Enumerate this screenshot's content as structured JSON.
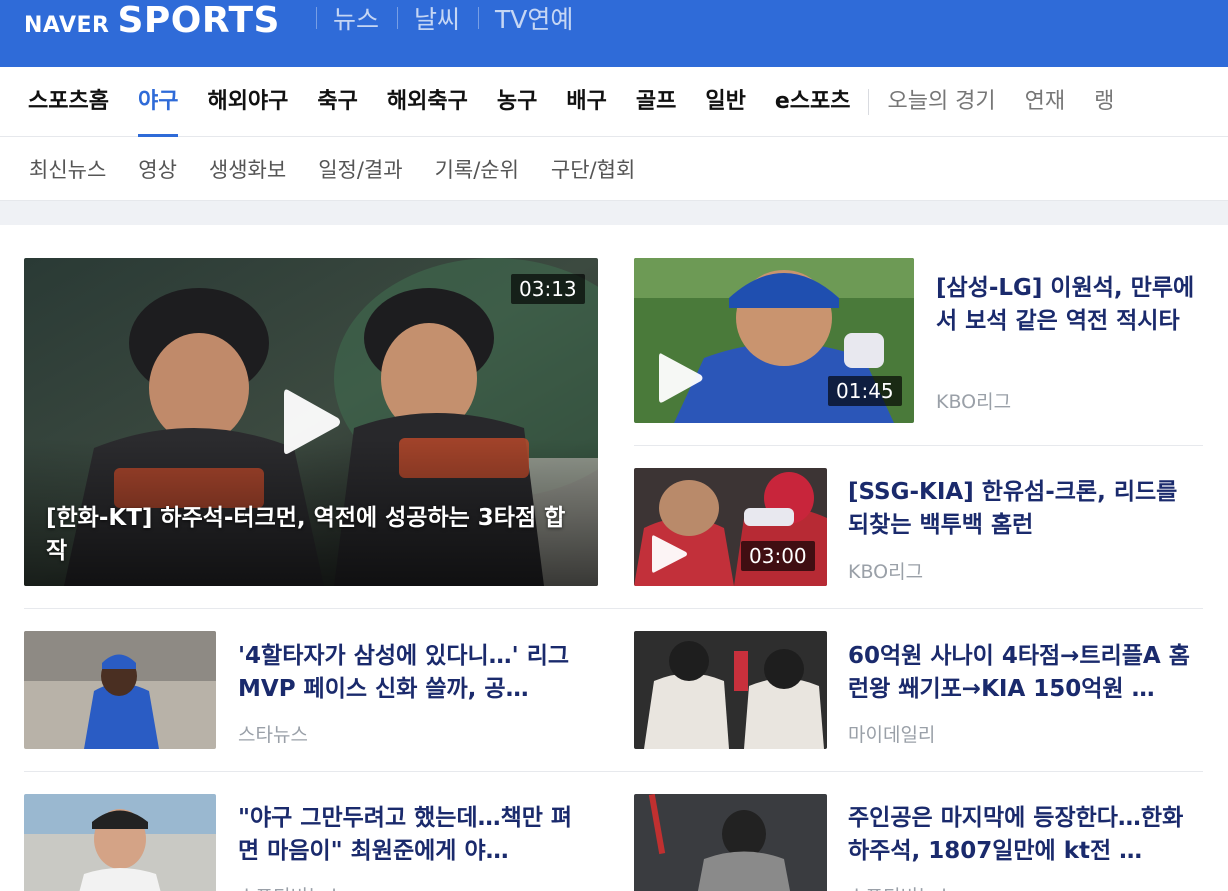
{
  "brand": {
    "naver": "NAVER",
    "sports": "SPORTS"
  },
  "top_nav": [
    "뉴스",
    "날씨",
    "TV연예"
  ],
  "category_nav": {
    "items": [
      "스포츠홈",
      "야구",
      "해외야구",
      "축구",
      "해외축구",
      "농구",
      "배구",
      "골프",
      "일반",
      "e스포츠"
    ],
    "active": "야구",
    "extra": [
      "오늘의 경기",
      "연재",
      "랭"
    ]
  },
  "sub_nav": [
    "최신뉴스",
    "영상",
    "생생화보",
    "일정/결과",
    "기록/순위",
    "구단/협회"
  ],
  "colors": {
    "brand_blue": "#2f6bd8",
    "title_navy": "#1a2a6c",
    "source_grey": "#9aa0a8"
  },
  "articles": {
    "featured": {
      "title": "[한화-KT] 하주석-터크먼, 역전에 성공하는 3타점 합작",
      "duration": "03:13"
    },
    "video1": {
      "title": "[삼성-LG] 이원석, 만루에서 보석 같은 역전 적시타",
      "duration": "01:45",
      "source": "KBO리그"
    },
    "video2": {
      "title": "[SSG-KIA] 한유섬-크론, 리드를 되찾는 백투백 홈런",
      "duration": "03:00",
      "source": "KBO리그"
    },
    "news1": {
      "title": "'4할타자가 삼성에 있다니…' 리그 MVP 페이스 신화 쓸까, 공…",
      "source": "스타뉴스"
    },
    "news2": {
      "title": "60억원 사나이 4타점→트리플A 홈런왕 쐐기포→KIA 150억원 …",
      "source": "마이데일리"
    },
    "news3": {
      "title": "\"야구 그만두려고 했는데…책만 펴면 마음이\" 최원준에게 야…",
      "source": "스포티비뉴스"
    },
    "news4": {
      "title": "주인공은 마지막에 등장한다…한화 하주석, 1807일만에 kt전 …",
      "source": "스포티비뉴스"
    }
  }
}
